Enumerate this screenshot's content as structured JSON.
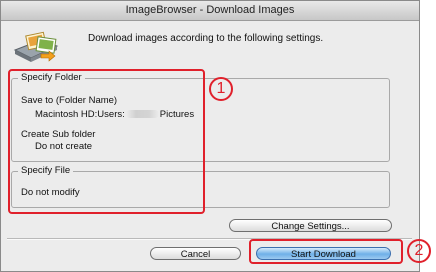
{
  "window": {
    "title": "ImageBrowser - Download Images"
  },
  "header": {
    "description": "Download images according to the following settings.",
    "icon": "scanner-photo-icon"
  },
  "specify_folder": {
    "legend": "Specify Folder",
    "save_to_label": "Save to (Folder Name)",
    "path_prefix": "Macintosh HD:Users:",
    "path_suffix": "Pictures",
    "subfolder_label": "Create Sub folder",
    "subfolder_value": "Do not create"
  },
  "specify_file": {
    "legend": "Specify File",
    "value": "Do not modify"
  },
  "buttons": {
    "change_settings": "Change Settings...",
    "cancel": "Cancel",
    "start_download": "Start Download"
  },
  "annotations": {
    "marker_1": "1",
    "marker_2": "2",
    "color": "#e0202b"
  }
}
